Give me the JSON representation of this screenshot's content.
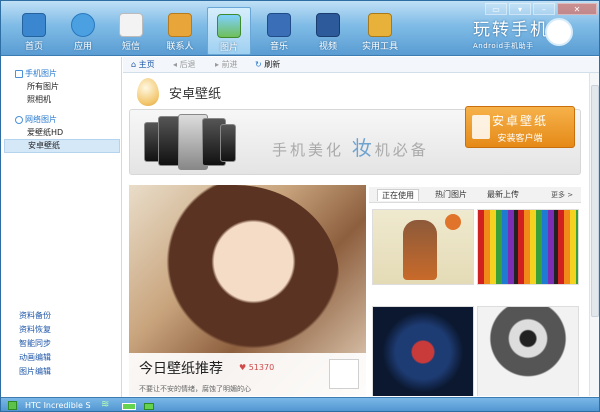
{
  "nav": {
    "items": [
      {
        "label": "首页",
        "icon": "home-icon",
        "color": "#3a86cf"
      },
      {
        "label": "应用",
        "icon": "apps-icon",
        "color": "#4aa0e0"
      },
      {
        "label": "短信",
        "icon": "sms-icon",
        "color": "#e8e8e8"
      },
      {
        "label": "联系人",
        "icon": "contacts-icon",
        "color": "#e8a53a"
      },
      {
        "label": "图片",
        "icon": "pictures-icon",
        "color": "#6fbf5a"
      },
      {
        "label": "音乐",
        "icon": "music-icon",
        "color": "#3a6fb8"
      },
      {
        "label": "视频",
        "icon": "video-icon",
        "color": "#2d5a9a"
      },
      {
        "label": "实用工具",
        "icon": "toolbox-icon",
        "color": "#e8b23a"
      }
    ],
    "active_index": 4
  },
  "brand": {
    "title": "玩转手机",
    "subtitle": "Android手机助手"
  },
  "sidebar": {
    "groups": [
      {
        "label": "手机图片",
        "items": [
          "所有图片",
          "照相机"
        ]
      },
      {
        "label": "网络图片",
        "items": [
          "爱壁纸HD",
          "安卓壁纸"
        ]
      }
    ],
    "selected": "安卓壁纸",
    "tools": [
      "资料备份",
      "资料恢复",
      "智能同步",
      "动画编辑",
      "图片编辑"
    ]
  },
  "toolbar": {
    "home": "主页",
    "back": "后退",
    "forward": "前进",
    "refresh": "刷新"
  },
  "page": {
    "title": "安卓壁纸",
    "slogan_pre": "手机美化",
    "slogan_hl": "妆",
    "slogan_post": "机必备",
    "download_title": "安卓壁纸",
    "download_sub": "安装客户端"
  },
  "feature": {
    "title": "今日壁纸推荐",
    "likes": "51370",
    "desc": "不要让不安的情绪，腐蚀了明媚的心"
  },
  "tabs": {
    "items": [
      "正在使用",
      "热门图片",
      "最新上传"
    ],
    "active": 0,
    "more": "更多 >"
  },
  "status": {
    "device": "HTC Incredible S"
  },
  "colors": {
    "accent": "#4a90c8",
    "download": "#e8951f",
    "link": "#2a7bd0"
  }
}
